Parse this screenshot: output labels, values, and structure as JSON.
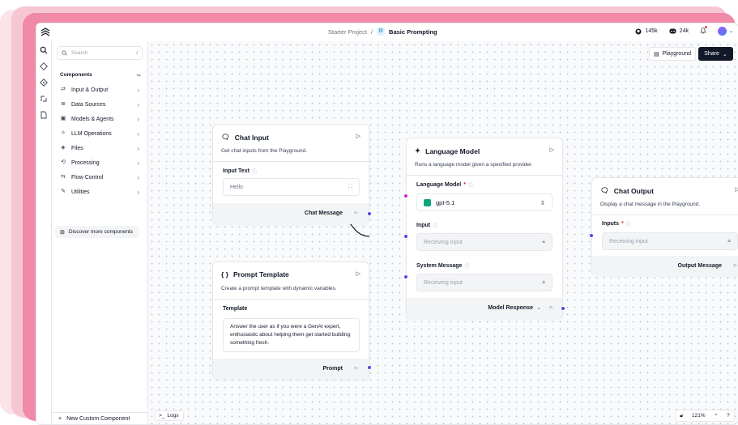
{
  "colors": {
    "accent": "#4f46e5",
    "brand_pink": "#f08aa6",
    "share_bg": "#111827",
    "openai_green": "#10a37f"
  },
  "topbar": {
    "project": "Starter Project",
    "separator": "/",
    "flow_name": "Basic Prompting",
    "github_stars": "145k",
    "discord_members": "24k",
    "icons": [
      "langflow-logo-icon",
      "github-icon",
      "discord-icon",
      "bell-icon",
      "avatar",
      "chevron-down-icon"
    ]
  },
  "rail": {
    "icons": [
      "search-icon",
      "components-icon",
      "bundles-icon",
      "mcp-icon",
      "files-icon"
    ]
  },
  "sidebar": {
    "search_placeholder": "Search",
    "search_shortcut": "/",
    "components_heading": "Components",
    "categories": [
      {
        "label": "Input & Output",
        "icon": "input-output-icon"
      },
      {
        "label": "Data Sources",
        "icon": "database-icon"
      },
      {
        "label": "Models & Agents",
        "icon": "models-icon"
      },
      {
        "label": "LLM Operations",
        "icon": "llm-ops-icon"
      },
      {
        "label": "Files",
        "icon": "files-icon"
      },
      {
        "label": "Processing",
        "icon": "processing-icon"
      },
      {
        "label": "Flow Control",
        "icon": "flow-control-icon"
      },
      {
        "label": "Utilities",
        "icon": "utilities-icon"
      }
    ],
    "discover_label": "Discover more components",
    "new_custom_label": "New Custom Component"
  },
  "canvas": {
    "playground_label": "Playground",
    "share_label": "Share",
    "logs_label": "Logs",
    "zoom": "121%"
  },
  "nodes": {
    "chat_input": {
      "title": "Chat Input",
      "description": "Get chat inputs from the Playground.",
      "field_label": "Input Text",
      "field_value": "Hello",
      "output": "Chat Message"
    },
    "prompt_template": {
      "title": "Prompt Template",
      "title_icon": "{ }",
      "description": "Create a prompt template with dynamic variables.",
      "field_label": "Template",
      "template_text": "Answer the user as if you were a GenAI expert, enthusiastic about helping them get started building something fresh.",
      "output": "Prompt"
    },
    "language_model": {
      "title": "Language Model",
      "description": "Runs a language model given a specified provider.",
      "model_label": "Language Model",
      "model_value": "gpt-5.1",
      "input_label": "Input",
      "input_placeholder": "Receiving input",
      "system_label": "System Message",
      "system_placeholder": "Receiving input",
      "output": "Model Response"
    },
    "chat_output": {
      "title": "Chat Output",
      "description": "Display a chat message in the Playground.",
      "field_label": "Inputs",
      "field_placeholder": "Receiving input",
      "output": "Output Message"
    }
  }
}
